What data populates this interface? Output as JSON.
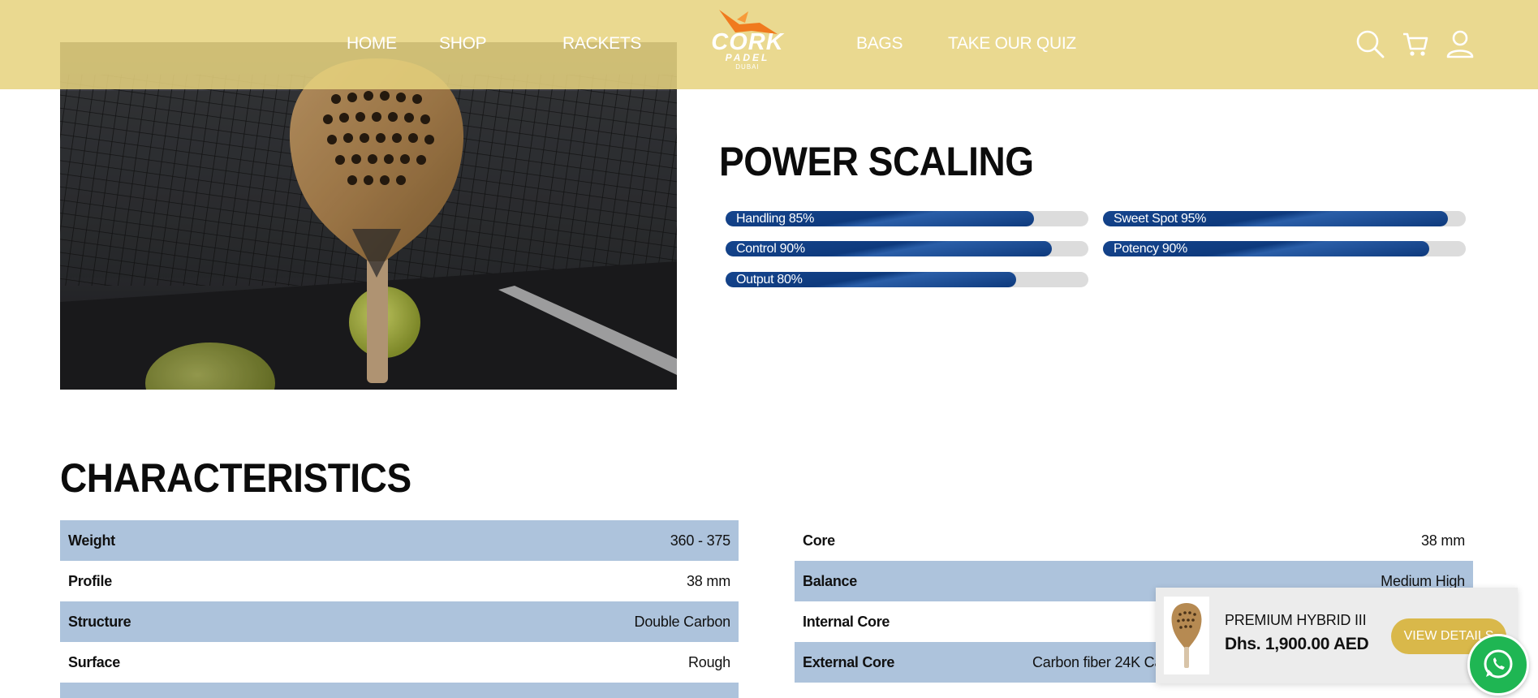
{
  "header": {
    "nav": [
      "HOME",
      "SHOP",
      "RACKETS",
      "BAGS",
      "TAKE OUR QUIZ"
    ],
    "logo": {
      "name": "CORK",
      "sub": "PADEL",
      "sub2": "DUBAI"
    },
    "icons": [
      "search-icon",
      "cart-icon",
      "account-icon"
    ]
  },
  "hero": {
    "image": "cork-padel-racket-on-court-photo"
  },
  "power_scaling": {
    "title": "POWER SCALING",
    "bars": [
      {
        "label": "Handling 85%",
        "value": 0.85
      },
      {
        "label": "Sweet Spot 95%",
        "value": 0.95
      },
      {
        "label": "Control 90%",
        "value": 0.9
      },
      {
        "label": "Potency 90%",
        "value": 0.9
      },
      {
        "label": "Output 80%",
        "value": 0.8
      }
    ],
    "colors": {
      "fill": "#0e3a7d",
      "track": "#dcdcdc"
    }
  },
  "characteristics": {
    "title": "CHARACTERISTICS",
    "left": [
      {
        "key": "Weight",
        "value": "360 - 375"
      },
      {
        "key": "Profile",
        "value": "38 mm"
      },
      {
        "key": "Structure",
        "value": "Double Carbon"
      },
      {
        "key": "Surface",
        "value": "Rough"
      }
    ],
    "right": [
      {
        "key": "Core",
        "value": "38 mm"
      },
      {
        "key": "Balance",
        "value": "Medium High"
      },
      {
        "key": "Internal Core",
        "value": ""
      },
      {
        "key": "External Core",
        "value": "Carbon fiber 24K Ca"
      }
    ]
  },
  "popup": {
    "name": "PREMIUM HYBRID III",
    "price": "Dhs. 1,900.00 AED",
    "button": "VIEW DETAILS"
  },
  "whatsapp": {
    "icon": "whatsapp-icon"
  },
  "colors": {
    "header": "#e7d37e",
    "accent": "#d9b84a",
    "table_shade": "#adc3dc",
    "whatsapp": "#1fb653"
  }
}
